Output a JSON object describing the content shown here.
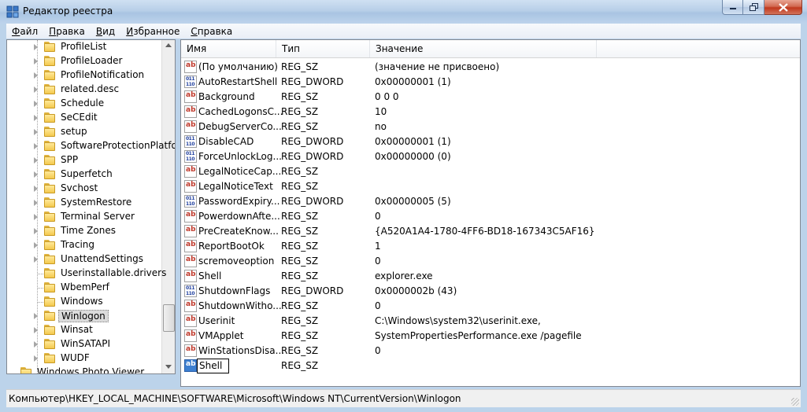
{
  "window": {
    "title": "Редактор реестра",
    "accent_color": "#bcd3ea",
    "close_color": "#c0381d"
  },
  "menu": [
    "Файл",
    "Правка",
    "Вид",
    "Избранное",
    "Справка"
  ],
  "tree": {
    "items": [
      {
        "label": "ProfileList",
        "expandable": true
      },
      {
        "label": "ProfileLoader",
        "expandable": true
      },
      {
        "label": "ProfileNotification",
        "expandable": true
      },
      {
        "label": "related.desc",
        "expandable": true
      },
      {
        "label": "Schedule",
        "expandable": true
      },
      {
        "label": "SeCEdit",
        "expandable": true
      },
      {
        "label": "setup",
        "expandable": true
      },
      {
        "label": "SoftwareProtectionPlatfo",
        "expandable": true
      },
      {
        "label": "SPP",
        "expandable": true
      },
      {
        "label": "Superfetch",
        "expandable": true
      },
      {
        "label": "Svchost",
        "expandable": true
      },
      {
        "label": "SystemRestore",
        "expandable": true
      },
      {
        "label": "Terminal Server",
        "expandable": true
      },
      {
        "label": "Time Zones",
        "expandable": true
      },
      {
        "label": "Tracing",
        "expandable": true
      },
      {
        "label": "UnattendSettings",
        "expandable": true
      },
      {
        "label": "Userinstallable.drivers",
        "expandable": false
      },
      {
        "label": "WbemPerf",
        "expandable": false
      },
      {
        "label": "Windows",
        "expandable": false
      },
      {
        "label": "Winlogon",
        "expandable": true,
        "selected": true
      },
      {
        "label": "Winsat",
        "expandable": true
      },
      {
        "label": "WinSATAPI",
        "expandable": true
      },
      {
        "label": "WUDF",
        "expandable": true
      }
    ],
    "cut_off_item": "Windows Photo Viewer"
  },
  "list": {
    "columns": [
      "Имя",
      "Тип",
      "Значение"
    ],
    "rows": [
      {
        "icon": "string-value-icon",
        "name": "(По умолчанию)",
        "type": "REG_SZ",
        "value": "(значение не присвоено)"
      },
      {
        "icon": "binary-value-icon",
        "name": "AutoRestartShell",
        "type": "REG_DWORD",
        "value": "0x00000001 (1)"
      },
      {
        "icon": "string-value-icon",
        "name": "Background",
        "type": "REG_SZ",
        "value": "0 0 0"
      },
      {
        "icon": "string-value-icon",
        "name": "CachedLogonsC...",
        "type": "REG_SZ",
        "value": "10"
      },
      {
        "icon": "string-value-icon",
        "name": "DebugServerCo...",
        "type": "REG_SZ",
        "value": "no"
      },
      {
        "icon": "binary-value-icon",
        "name": "DisableCAD",
        "type": "REG_DWORD",
        "value": "0x00000001 (1)"
      },
      {
        "icon": "binary-value-icon",
        "name": "ForceUnlockLog...",
        "type": "REG_DWORD",
        "value": "0x00000000 (0)"
      },
      {
        "icon": "string-value-icon",
        "name": "LegalNoticeCap...",
        "type": "REG_SZ",
        "value": ""
      },
      {
        "icon": "string-value-icon",
        "name": "LegalNoticeText",
        "type": "REG_SZ",
        "value": ""
      },
      {
        "icon": "binary-value-icon",
        "name": "PasswordExpiry...",
        "type": "REG_DWORD",
        "value": "0x00000005 (5)"
      },
      {
        "icon": "string-value-icon",
        "name": "PowerdownAfte...",
        "type": "REG_SZ",
        "value": "0"
      },
      {
        "icon": "string-value-icon",
        "name": "PreCreateKnow...",
        "type": "REG_SZ",
        "value": "{A520A1A4-1780-4FF6-BD18-167343C5AF16}"
      },
      {
        "icon": "string-value-icon",
        "name": "ReportBootOk",
        "type": "REG_SZ",
        "value": "1"
      },
      {
        "icon": "string-value-icon",
        "name": "scremoveoption",
        "type": "REG_SZ",
        "value": "0"
      },
      {
        "icon": "string-value-icon",
        "name": "Shell",
        "type": "REG_SZ",
        "value": "explorer.exe"
      },
      {
        "icon": "binary-value-icon",
        "name": "ShutdownFlags",
        "type": "REG_DWORD",
        "value": "0x0000002b (43)"
      },
      {
        "icon": "string-value-icon",
        "name": "ShutdownWitho...",
        "type": "REG_SZ",
        "value": "0"
      },
      {
        "icon": "string-value-icon",
        "name": "Userinit",
        "type": "REG_SZ",
        "value": "C:\\Windows\\system32\\userinit.exe,"
      },
      {
        "icon": "string-value-icon",
        "name": "VMApplet",
        "type": "REG_SZ",
        "value": "SystemPropertiesPerformance.exe /pagefile"
      },
      {
        "icon": "string-value-icon",
        "name": "WinStationsDisa...",
        "type": "REG_SZ",
        "value": "0"
      },
      {
        "icon": "string-value-icon",
        "name": "Shell",
        "type": "REG_SZ",
        "value": "",
        "editing": true
      }
    ]
  },
  "statusbar": {
    "path": "Компьютер\\HKEY_LOCAL_MACHINE\\SOFTWARE\\Microsoft\\Windows NT\\CurrentVersion\\Winlogon"
  }
}
